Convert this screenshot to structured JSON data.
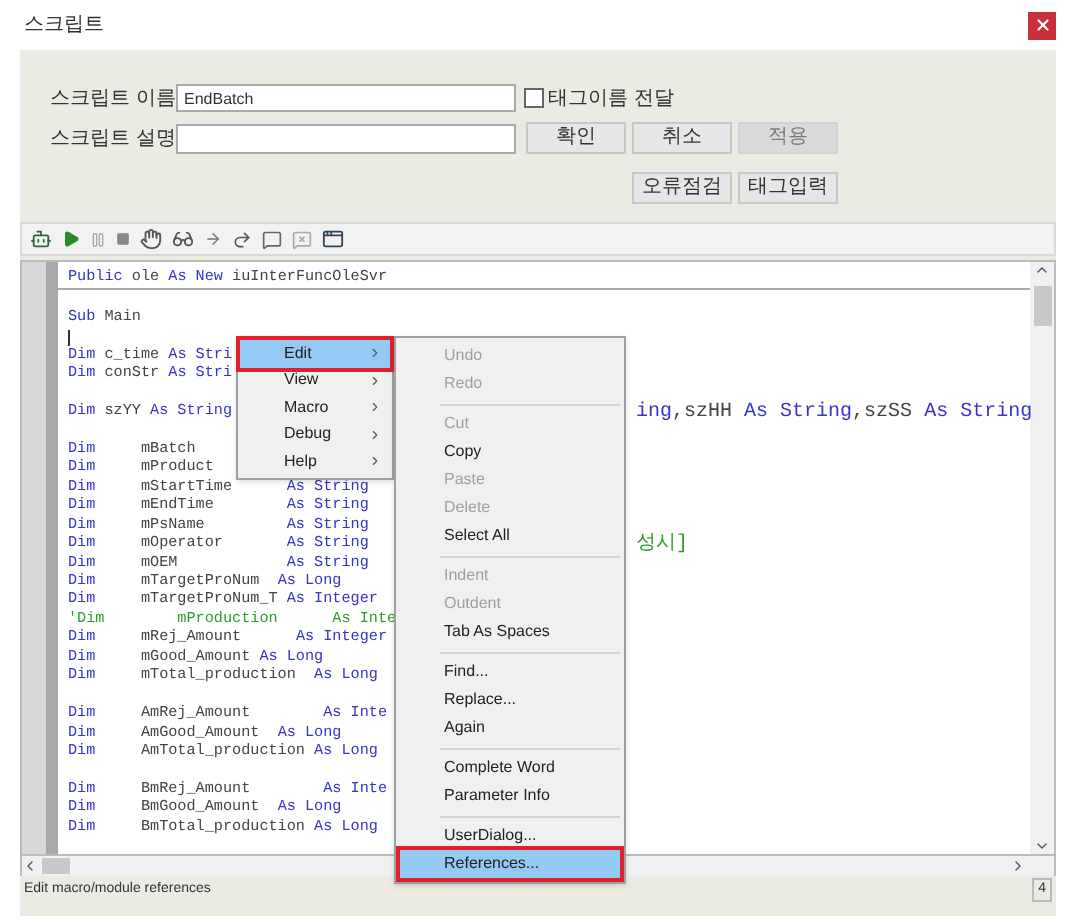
{
  "window": {
    "title": "스크립트"
  },
  "form": {
    "name_label": "스크립트 이름",
    "name_value": "EndBatch",
    "pass_tag": {
      "label": "태그이름 전달",
      "checked": false
    },
    "desc_label": "스크립트 설명",
    "buttons": [
      {
        "label": "확인",
        "disabled": false
      },
      {
        "label": "취소",
        "disabled": false
      },
      {
        "label": "적용",
        "disabled": true
      }
    ],
    "buttons_row2": [
      {
        "label": "오류점검",
        "disabled": false
      },
      {
        "label": "태그입력",
        "disabled": false
      }
    ]
  },
  "header_line": [
    {
      "kind": "keyword",
      "text": "Public"
    },
    {
      "kind": "name",
      "text": " ole "
    },
    {
      "kind": "keyword",
      "text": "As New"
    },
    {
      "kind": "name",
      "text": " iuInterFuncOleSvr"
    }
  ],
  "code_lines": [
    {
      "kind": "blank"
    },
    {
      "kind": "code",
      "parts": [
        {
          "kind": "keyword",
          "text": "Sub"
        },
        {
          "kind": "name",
          "text": " Main"
        }
      ]
    },
    {
      "kind": "cursor"
    },
    {
      "kind": "code",
      "parts": [
        {
          "kind": "keyword",
          "text": "Dim"
        },
        {
          "kind": "name",
          "text": " c_time "
        },
        {
          "kind": "keyword",
          "text": "As Stri"
        }
      ]
    },
    {
      "kind": "code",
      "parts": [
        {
          "kind": "keyword",
          "text": "Dim"
        },
        {
          "kind": "name",
          "text": " conStr "
        },
        {
          "kind": "keyword",
          "text": "As Stri"
        }
      ]
    },
    {
      "kind": "blank"
    },
    {
      "kind": "code",
      "parts": [
        {
          "kind": "keyword",
          "text": "Dim"
        },
        {
          "kind": "name",
          "text": " szYY "
        },
        {
          "kind": "keyword",
          "text": "As String"
        }
      ],
      "tail": [
        {
          "kind": "keyword",
          "text": "ing"
        },
        {
          "kind": "name",
          "text": ",szHH "
        },
        {
          "kind": "keyword",
          "text": "As String"
        },
        {
          "kind": "name",
          "text": ",szSS "
        },
        {
          "kind": "keyword",
          "text": "As String"
        }
      ]
    },
    {
      "kind": "blank"
    },
    {
      "kind": "code",
      "parts": [
        {
          "kind": "keyword",
          "text": "Dim"
        },
        {
          "kind": "name",
          "text": "     mBatch"
        }
      ]
    },
    {
      "kind": "code",
      "parts": [
        {
          "kind": "keyword",
          "text": "Dim"
        },
        {
          "kind": "name",
          "text": "     mProduct"
        }
      ]
    },
    {
      "kind": "code",
      "parts": [
        {
          "kind": "keyword",
          "text": "Dim"
        },
        {
          "kind": "name",
          "text": "     mStartTime      "
        },
        {
          "kind": "keyword",
          "text": "As String"
        }
      ]
    },
    {
      "kind": "code",
      "parts": [
        {
          "kind": "keyword",
          "text": "Dim"
        },
        {
          "kind": "name",
          "text": "     mEndTime        "
        },
        {
          "kind": "keyword",
          "text": "As String"
        }
      ]
    },
    {
      "kind": "code",
      "parts": [
        {
          "kind": "keyword",
          "text": "Dim"
        },
        {
          "kind": "name",
          "text": "     mPsName         "
        },
        {
          "kind": "keyword",
          "text": "As String"
        }
      ]
    },
    {
      "kind": "code",
      "parts": [
        {
          "kind": "keyword",
          "text": "Dim"
        },
        {
          "kind": "name",
          "text": "     mOperator       "
        },
        {
          "kind": "keyword",
          "text": "As String"
        }
      ],
      "tail": [
        {
          "kind": "comment",
          "text": "성시]"
        }
      ]
    },
    {
      "kind": "code",
      "parts": [
        {
          "kind": "keyword",
          "text": "Dim"
        },
        {
          "kind": "name",
          "text": "     mOEM            "
        },
        {
          "kind": "keyword",
          "text": "As String"
        }
      ]
    },
    {
      "kind": "code",
      "parts": [
        {
          "kind": "keyword",
          "text": "Dim"
        },
        {
          "kind": "name",
          "text": "     mTargetProNum  "
        },
        {
          "kind": "keyword",
          "text": "As Long"
        }
      ]
    },
    {
      "kind": "code",
      "parts": [
        {
          "kind": "keyword",
          "text": "Dim"
        },
        {
          "kind": "name",
          "text": "     mTargetProNum_T "
        },
        {
          "kind": "keyword",
          "text": "As Integer"
        }
      ]
    },
    {
      "kind": "code",
      "parts": [
        {
          "kind": "comment",
          "text": "'Dim        mProduction      As Inte"
        }
      ]
    },
    {
      "kind": "code",
      "parts": [
        {
          "kind": "keyword",
          "text": "Dim"
        },
        {
          "kind": "name",
          "text": "     mRej_Amount      "
        },
        {
          "kind": "keyword",
          "text": "As Integer"
        }
      ]
    },
    {
      "kind": "code",
      "parts": [
        {
          "kind": "keyword",
          "text": "Dim"
        },
        {
          "kind": "name",
          "text": "     mGood_Amount "
        },
        {
          "kind": "keyword",
          "text": "As Long"
        }
      ]
    },
    {
      "kind": "code",
      "parts": [
        {
          "kind": "keyword",
          "text": "Dim"
        },
        {
          "kind": "name",
          "text": "     mTotal_production  "
        },
        {
          "kind": "keyword",
          "text": "As Long"
        }
      ]
    },
    {
      "kind": "blank"
    },
    {
      "kind": "code",
      "parts": [
        {
          "kind": "keyword",
          "text": "Dim"
        },
        {
          "kind": "name",
          "text": "     AmRej_Amount        "
        },
        {
          "kind": "keyword",
          "text": "As Inte"
        }
      ]
    },
    {
      "kind": "code",
      "parts": [
        {
          "kind": "keyword",
          "text": "Dim"
        },
        {
          "kind": "name",
          "text": "     AmGood_Amount  "
        },
        {
          "kind": "keyword",
          "text": "As Long"
        }
      ]
    },
    {
      "kind": "code",
      "parts": [
        {
          "kind": "keyword",
          "text": "Dim"
        },
        {
          "kind": "name",
          "text": "     AmTotal_production "
        },
        {
          "kind": "keyword",
          "text": "As Long"
        }
      ]
    },
    {
      "kind": "blank"
    },
    {
      "kind": "code",
      "parts": [
        {
          "kind": "keyword",
          "text": "Dim"
        },
        {
          "kind": "name",
          "text": "     BmRej_Amount        "
        },
        {
          "kind": "keyword",
          "text": "As Inte"
        }
      ]
    },
    {
      "kind": "code",
      "parts": [
        {
          "kind": "keyword",
          "text": "Dim"
        },
        {
          "kind": "name",
          "text": "     BmGood_Amount  "
        },
        {
          "kind": "keyword",
          "text": "As Long"
        }
      ]
    },
    {
      "kind": "code",
      "parts": [
        {
          "kind": "keyword",
          "text": "Dim"
        },
        {
          "kind": "name",
          "text": "     BmTotal_production "
        },
        {
          "kind": "keyword",
          "text": "As Long"
        }
      ]
    }
  ],
  "context_menu": [
    {
      "label": "Edit",
      "selected": true,
      "submenu": true
    },
    {
      "label": "View",
      "selected": false,
      "submenu": true
    },
    {
      "label": "Macro",
      "selected": false,
      "submenu": true
    },
    {
      "label": "Debug",
      "selected": false,
      "submenu": true
    },
    {
      "label": "Help",
      "selected": false,
      "submenu": true
    }
  ],
  "edit_menu": [
    {
      "kind": "item",
      "label": "Undo",
      "disabled": true,
      "selected": false
    },
    {
      "kind": "item",
      "label": "Redo",
      "disabled": true,
      "selected": false
    },
    {
      "kind": "separator"
    },
    {
      "kind": "item",
      "label": "Cut",
      "disabled": true,
      "selected": false
    },
    {
      "kind": "item",
      "label": "Copy",
      "disabled": false,
      "selected": false
    },
    {
      "kind": "item",
      "label": "Paste",
      "disabled": true,
      "selected": false
    },
    {
      "kind": "item",
      "label": "Delete",
      "disabled": true,
      "selected": false
    },
    {
      "kind": "item",
      "label": "Select All",
      "disabled": false,
      "selected": false
    },
    {
      "kind": "separator"
    },
    {
      "kind": "item",
      "label": "Indent",
      "disabled": true,
      "selected": false
    },
    {
      "kind": "item",
      "label": "Outdent",
      "disabled": true,
      "selected": false
    },
    {
      "kind": "item",
      "label": "Tab As Spaces",
      "disabled": false,
      "selected": false
    },
    {
      "kind": "separator"
    },
    {
      "kind": "item",
      "label": "Find...",
      "disabled": false,
      "selected": false
    },
    {
      "kind": "item",
      "label": "Replace...",
      "disabled": false,
      "selected": false
    },
    {
      "kind": "item",
      "label": "Again",
      "disabled": false,
      "selected": false
    },
    {
      "kind": "separator"
    },
    {
      "kind": "item",
      "label": "Complete Word",
      "disabled": false,
      "selected": false
    },
    {
      "kind": "item",
      "label": "Parameter Info",
      "disabled": false,
      "selected": false
    },
    {
      "kind": "separator"
    },
    {
      "kind": "item",
      "label": "UserDialog...",
      "disabled": false,
      "selected": false
    },
    {
      "kind": "item",
      "label": "References...",
      "disabled": false,
      "selected": true
    }
  ],
  "status_bar": {
    "text": "Edit macro/module references",
    "line": "4"
  }
}
